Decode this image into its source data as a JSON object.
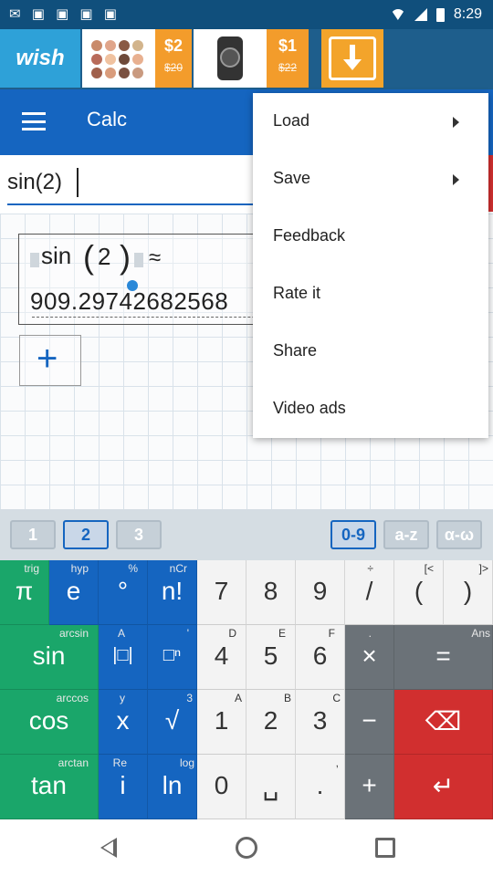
{
  "status_bar": {
    "time": "8:29"
  },
  "ad": {
    "brand": "wish",
    "offers": [
      {
        "price": "$2",
        "old_price": "$20"
      },
      {
        "price": "$1",
        "old_price": "$22"
      }
    ]
  },
  "toolbar": {
    "title": "Calc"
  },
  "input": {
    "expression": "sin(2)"
  },
  "result": {
    "func": "sin",
    "open_paren": "(",
    "arg": "2",
    "close_paren": ")",
    "approx_sign": "≈",
    "value": "909.29742682568"
  },
  "add_label": "+",
  "menu": {
    "items": [
      {
        "label": "Load",
        "submenu": true
      },
      {
        "label": "Save",
        "submenu": true
      },
      {
        "label": "Feedback",
        "submenu": false
      },
      {
        "label": "Rate it",
        "submenu": false
      },
      {
        "label": "Share",
        "submenu": false
      },
      {
        "label": "Video ads",
        "submenu": false
      }
    ]
  },
  "tabs": {
    "pages": [
      "1",
      "2",
      "3"
    ],
    "selected_page": "2",
    "modes": [
      "0-9",
      "a-z",
      "α-ω"
    ],
    "selected_mode": "0-9"
  },
  "keypad": {
    "rows": [
      [
        {
          "main": "π",
          "sub": "trig"
        },
        {
          "main": "e",
          "sub": "hyp"
        },
        {
          "main": "°",
          "sub": "%"
        },
        {
          "main": "n!",
          "sub": "nCr"
        },
        {
          "main": "7",
          "sub": ""
        },
        {
          "main": "8",
          "sub": ""
        },
        {
          "main": "9",
          "sub": ""
        },
        {
          "main": "/",
          "sub": "÷"
        },
        {
          "main": "(",
          "sub": "[<"
        },
        {
          "main": ")",
          "sub": "]>"
        }
      ],
      [
        {
          "main": "sin",
          "sub": "arcsin"
        },
        {
          "main": "|□|",
          "sub": "A"
        },
        {
          "main": "□ⁿ",
          "sub": "'"
        },
        {
          "main": "4",
          "sub": "D"
        },
        {
          "main": "5",
          "sub": "E"
        },
        {
          "main": "6",
          "sub": "F"
        },
        {
          "main": "×",
          "sub": "."
        },
        {
          "main": "=",
          "sub": "Ans"
        }
      ],
      [
        {
          "main": "cos",
          "sub": "arccos"
        },
        {
          "main": "x",
          "sub": "y"
        },
        {
          "main": "√",
          "sub": "3"
        },
        {
          "main": "1",
          "sub": "A"
        },
        {
          "main": "2",
          "sub": "B"
        },
        {
          "main": "3",
          "sub": "C"
        },
        {
          "main": "−",
          "sub": ""
        },
        {
          "main": "⌫",
          "sub": ""
        }
      ],
      [
        {
          "main": "tan",
          "sub": "arctan"
        },
        {
          "main": "i",
          "sub": "Re"
        },
        {
          "main": "ln",
          "sub": "log"
        },
        {
          "main": "0",
          "sub": ""
        },
        {
          "main": "␣",
          "sub": ""
        },
        {
          "main": ".",
          "sub": ","
        },
        {
          "main": "+",
          "sub": ""
        },
        {
          "main": "↵",
          "sub": ""
        }
      ]
    ]
  },
  "colors": {
    "toolbar": "#1565c0",
    "status_bar": "#104f7c",
    "function_keys": "#1aa66a",
    "symbol_keys": "#1565c0",
    "digit_keys": "#f3f3f3",
    "operator_keys": "#6b7278",
    "action_keys": "#d12f2f"
  }
}
